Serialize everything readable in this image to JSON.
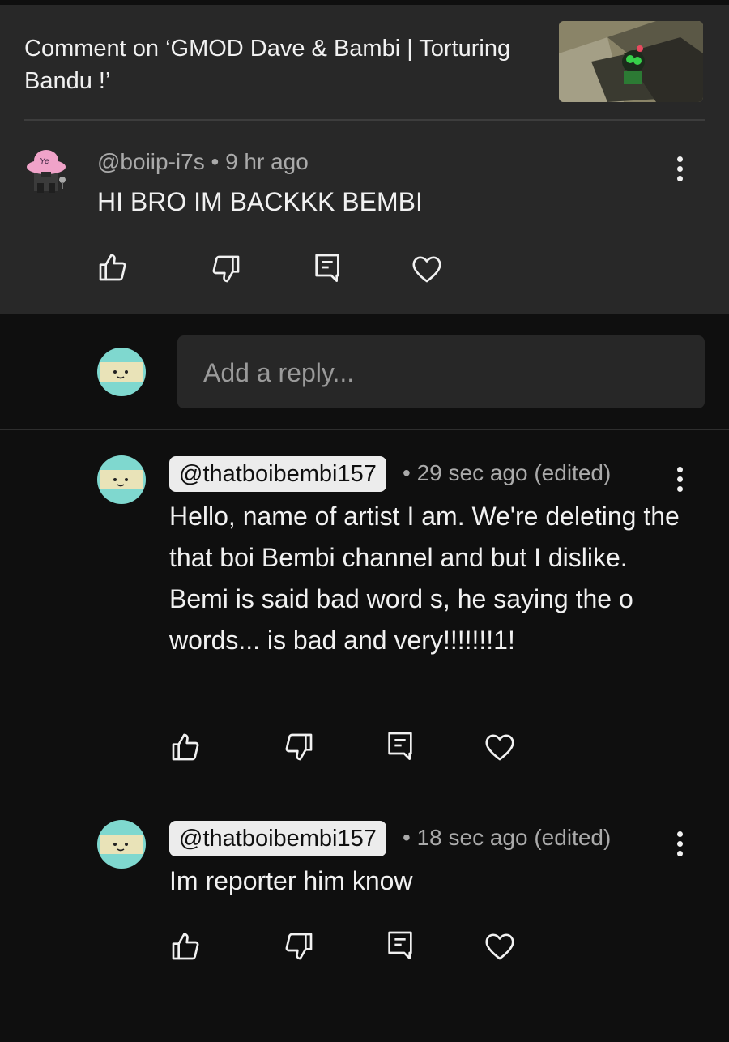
{
  "header": {
    "title": "Comment on ‘GMOD Dave & Bambi | Torturing Bandu !’"
  },
  "main_comment": {
    "author": "@boiip-i7s",
    "time": "• 9 hr ago",
    "text": "HI BRO IM BACKKK BEMBI",
    "avatar_label": "Ye"
  },
  "reply_input": {
    "placeholder": "Add a reply..."
  },
  "replies": [
    {
      "author": "@thatboibembi157",
      "time": "• 29 sec ago (edited)",
      "text": "Hello, name of artist I am. We're deleting the that boi Bembi channel and but I dislike. Bemi is said bad word s, he saying the o words... is bad and very!!!!!!!1!"
    },
    {
      "author": "@thatboibembi157",
      "time": "• 18 sec ago (edited)",
      "text": "Im reporter him know"
    }
  ],
  "icons": [
    "like-icon",
    "dislike-icon",
    "reply-icon",
    "heart-icon",
    "more-options-icon"
  ],
  "colors": {
    "header_bg": "#282828",
    "page_bg": "#0f0f0f",
    "chip_bg": "#ececec",
    "avatar_teal": "#7fd8cf"
  }
}
